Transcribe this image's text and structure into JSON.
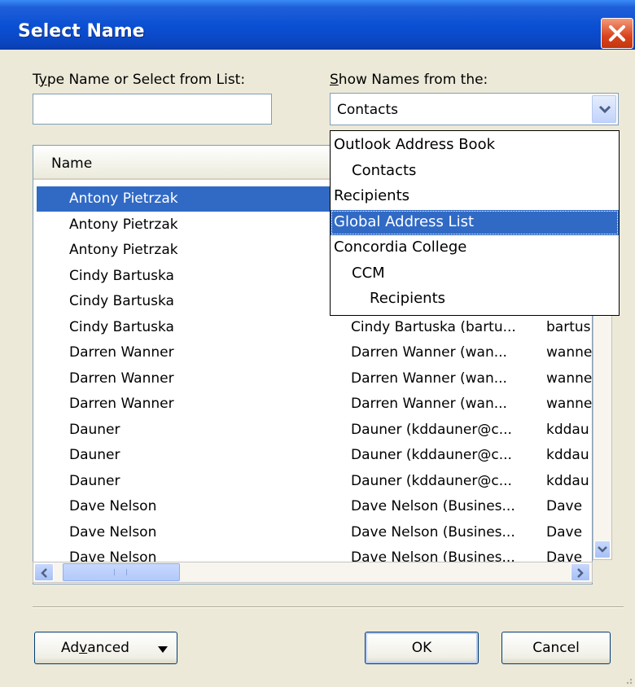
{
  "window": {
    "title": "Select Name"
  },
  "search": {
    "label_pre": "T",
    "label_u": "y",
    "label_post": "pe Name or Select from List:",
    "value": ""
  },
  "source": {
    "label_u": "S",
    "label_post": "how Names from the:",
    "value": "Contacts",
    "options": [
      {
        "label": "Outlook Address Book",
        "indent": 0,
        "selected": false
      },
      {
        "label": "Contacts",
        "indent": 1,
        "selected": false
      },
      {
        "label": "Recipients",
        "indent": 0,
        "selected": false
      },
      {
        "label": "Global Address List",
        "indent": 0,
        "selected": true
      },
      {
        "label": "Concordia College",
        "indent": 0,
        "selected": false
      },
      {
        "label": "CCM",
        "indent": 1,
        "selected": false
      },
      {
        "label": "Recipients",
        "indent": 2,
        "selected": false
      }
    ]
  },
  "table": {
    "headers": [
      "Name"
    ],
    "rows": [
      {
        "name": "Antony Pietrzak",
        "display": "",
        "email": "",
        "selected": true
      },
      {
        "name": "Antony Pietrzak",
        "display": "",
        "email": ""
      },
      {
        "name": "Antony Pietrzak",
        "display": "",
        "email": ""
      },
      {
        "name": "Cindy Bartuska",
        "display": "",
        "email": ""
      },
      {
        "name": "Cindy Bartuska",
        "display": "",
        "email": ""
      },
      {
        "name": "Cindy Bartuska",
        "display": "Cindy Bartuska (bartu...",
        "email": "bartus"
      },
      {
        "name": "Darren Wanner",
        "display": "Darren Wanner (wan...",
        "email": "wanne"
      },
      {
        "name": "Darren Wanner",
        "display": "Darren Wanner (wan...",
        "email": "wanne"
      },
      {
        "name": "Darren Wanner",
        "display": "Darren Wanner (wan...",
        "email": "wanne"
      },
      {
        "name": "Dauner",
        "display": "Dauner (kddauner@c...",
        "email": "kddau"
      },
      {
        "name": "Dauner",
        "display": "Dauner (kddauner@c...",
        "email": "kddau"
      },
      {
        "name": "Dauner",
        "display": "Dauner (kddauner@c...",
        "email": "kddau"
      },
      {
        "name": "Dave Nelson",
        "display": "Dave Nelson (Busines...",
        "email": "Dave"
      },
      {
        "name": "Dave Nelson",
        "display": "Dave Nelson (Busines...",
        "email": "Dave"
      },
      {
        "name": "Dave Nelson",
        "display": "Dave Nelson (Busines...",
        "email": "Dave"
      }
    ]
  },
  "buttons": {
    "advanced_pre": "Ad",
    "advanced_u": "v",
    "advanced_post": "anced",
    "ok": "OK",
    "cancel": "Cancel"
  },
  "icons": {
    "close": "close-icon",
    "dropdown": "chevron-down-icon",
    "scroll_left": "arrow-left-icon",
    "scroll_right": "arrow-right-icon",
    "scroll_down": "arrow-down-icon",
    "menu_arrow": "caret-down-icon"
  }
}
